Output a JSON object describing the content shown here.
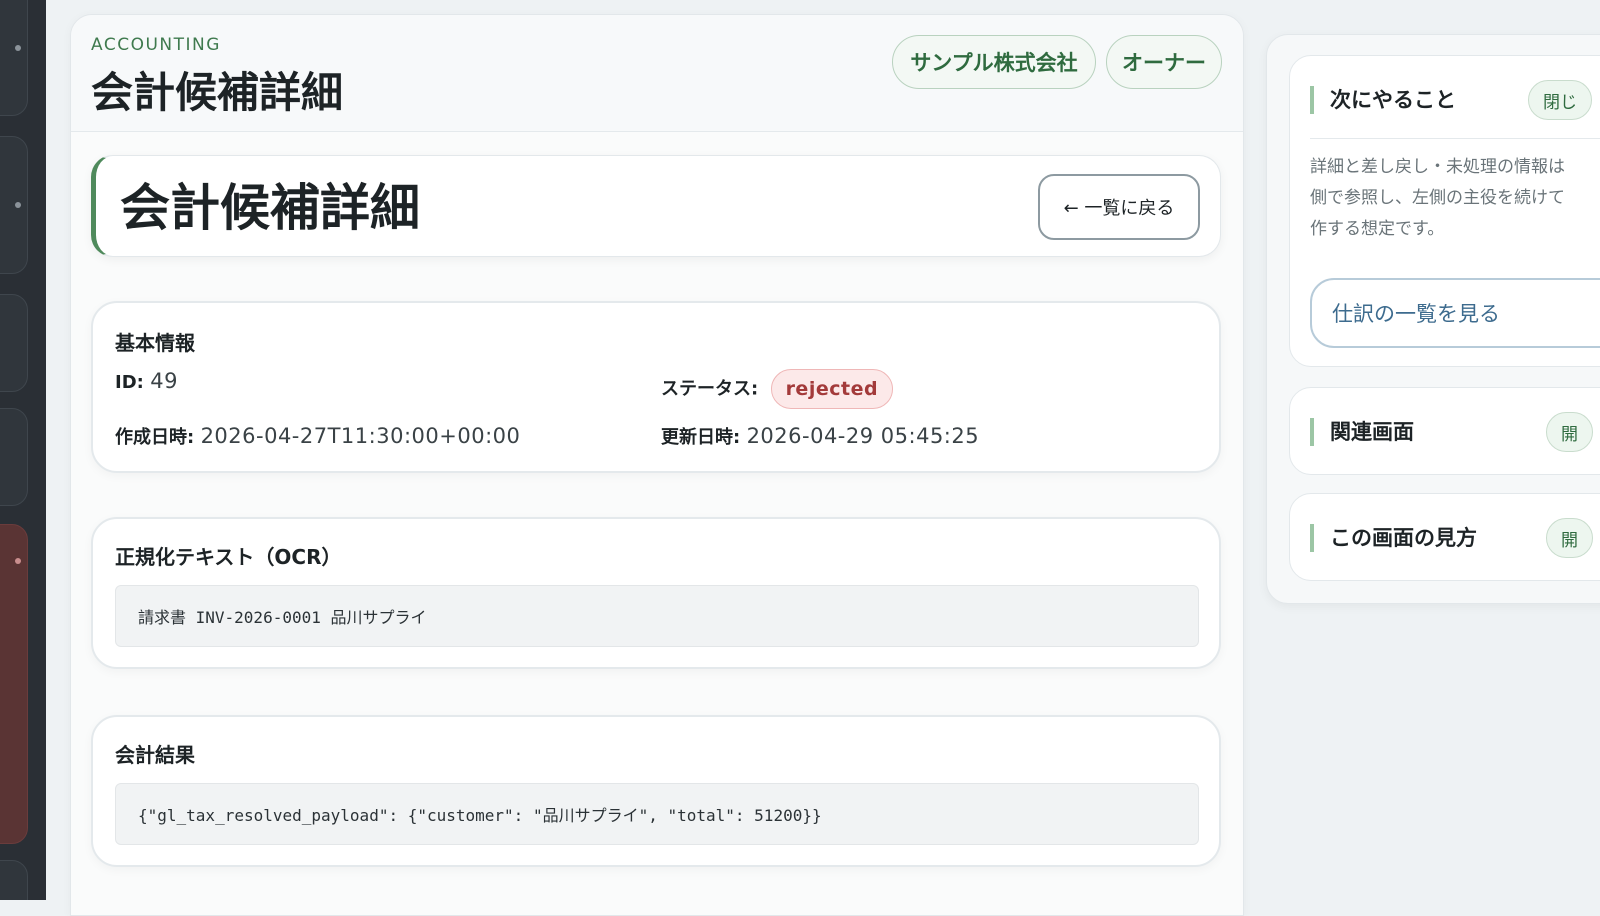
{
  "header": {
    "eyebrow": "ACCOUNTING",
    "title": "会計候補詳細",
    "company": "サンプル株式会社",
    "role": "オーナー"
  },
  "hero": {
    "title": "会計候補詳細",
    "back_label": "← 一覧に戻る"
  },
  "basic_info": {
    "title": "基本情報",
    "id_label": "ID:",
    "id_value": "49",
    "status_label": "ステータス:",
    "status_value": "rejected",
    "created_label": "作成日時:",
    "created_value": "2026-04-27T11:30:00+00:00",
    "updated_label": "更新日時:",
    "updated_value": "2026-04-29 05:45:25"
  },
  "ocr": {
    "title": "正規化テキスト（OCR）",
    "text": "請求書 INV-2026-0001 品川サプライ"
  },
  "result": {
    "title": "会計結果",
    "text": "{\"gl_tax_resolved_payload\": {\"customer\": \"品川サプライ\", \"total\": 51200}}"
  },
  "right_panel": {
    "next": {
      "title": "次にやること",
      "toggle": "閉じ",
      "description": "詳細と差し戻し・未処理の情報は\n側で参照し、左側の主役を続けて\n作する想定です。",
      "link": "仕訳の一覧を見る"
    },
    "related": {
      "title": "関連画面",
      "toggle": "開"
    },
    "howto": {
      "title": "この画面の見方",
      "toggle": "開"
    }
  },
  "colors": {
    "accent_green": "#4f8a5c",
    "status_rejected": "#a33a3a",
    "sidebar_bg": "#2a2f35"
  }
}
